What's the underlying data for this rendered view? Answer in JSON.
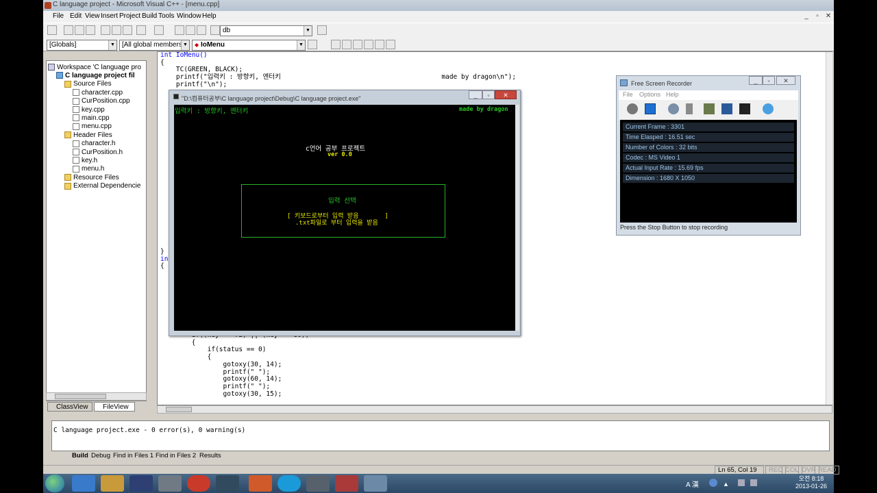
{
  "window": {
    "title": "C language project - Microsoft Visual C++ - [menu.cpp]"
  },
  "menubar": [
    "File",
    "Edit",
    "View",
    "Insert",
    "Project",
    "Build",
    "Tools",
    "Window",
    "Help"
  ],
  "toolbar": {
    "find_combo": "db",
    "scope_combo": "[Globals]",
    "members_combo": "[All global members",
    "function_combo": "IoMenu"
  },
  "workspace": {
    "items": [
      {
        "label": "Workspace 'C language pro",
        "level": 0,
        "type": "ws"
      },
      {
        "label": "C language project fil",
        "level": 1,
        "type": "proj"
      },
      {
        "label": "Source Files",
        "level": 2,
        "type": "folder"
      },
      {
        "label": "character.cpp",
        "level": 3,
        "type": "file"
      },
      {
        "label": "CurPosition.cpp",
        "level": 3,
        "type": "file"
      },
      {
        "label": "key.cpp",
        "level": 3,
        "type": "file"
      },
      {
        "label": "main.cpp",
        "level": 3,
        "type": "file"
      },
      {
        "label": "menu.cpp",
        "level": 3,
        "type": "file"
      },
      {
        "label": "Header Files",
        "level": 2,
        "type": "folder"
      },
      {
        "label": "character.h",
        "level": 3,
        "type": "file"
      },
      {
        "label": "CurPosition.h",
        "level": 3,
        "type": "file"
      },
      {
        "label": "key.h",
        "level": 3,
        "type": "file"
      },
      {
        "label": "menu.h",
        "level": 3,
        "type": "file"
      },
      {
        "label": "Resource Files",
        "level": 2,
        "type": "folder"
      },
      {
        "label": "External Dependencie",
        "level": 2,
        "type": "folder"
      }
    ],
    "tabs": {
      "classview": "ClassView",
      "fileview": "FileView"
    }
  },
  "editor": {
    "top_lines": [
      "int IoMenu()",
      "{",
      "    TC(GREEN, BLACK);",
      "    printf(\"입력키 : 방향키, 엔터키                                         made by dragon\\n\");",
      "    printf(\"\\n\");"
    ],
    "mid_lines": [
      "}",
      "",
      "in",
      "{"
    ],
    "bottom_lines": [
      "        if((key == 72) || (key == 80))",
      "        {",
      "            if(status == 0)",
      "            {",
      "                gotoxy(30, 14);",
      "                printf(\" \");",
      "                gotoxy(60, 14);",
      "                printf(\" \");",
      "",
      "                gotoxy(30, 15);"
    ]
  },
  "output": {
    "line": "C language project.exe - 0 error(s), 0 warning(s)",
    "tabs": [
      "Build",
      "Debug",
      "Find in Files 1",
      "Find in Files 2",
      "Results"
    ]
  },
  "statusbar": {
    "position": "Ln 65, Col 19",
    "rec": "REC",
    "col": "COL",
    "ovr": "OVR",
    "read": "READ"
  },
  "console": {
    "title": "\"D:\\컴퓨터공부\\C language project\\Debug\\C language project.exe\"",
    "header_left": "입력키 : 방향키, 엔터키",
    "header_right": "made by dragon",
    "app_title": "c언어 공부 프로젝트",
    "version": "ver 0.0",
    "box_title": "입력 선택",
    "option1": "[ 키보드로부터 입력 받음       ]",
    "option2": ".txt파일로 부터 입력을 받음"
  },
  "recorder": {
    "title": "Free Screen Recorder",
    "menu": [
      "File",
      "Options",
      "Help"
    ],
    "rows": [
      "Current Frame : 3301",
      "Time Elasped : 16.51 sec",
      "Number of Colors : 32 bits",
      "Codec : MS Video 1",
      "Actual Input Rate : 15.69 fps",
      "Dimension : 1680 X 1050"
    ],
    "status": "Press the Stop Button to stop recording"
  },
  "taskbar": {
    "time": "오전 8:18",
    "date": "2013-01-26",
    "ime": "A 漢"
  },
  "colors": {
    "console_green": "#27c427",
    "console_yellow": "#e6e600",
    "console_white": "#ffffff",
    "keyword_blue": "#0000ff"
  }
}
